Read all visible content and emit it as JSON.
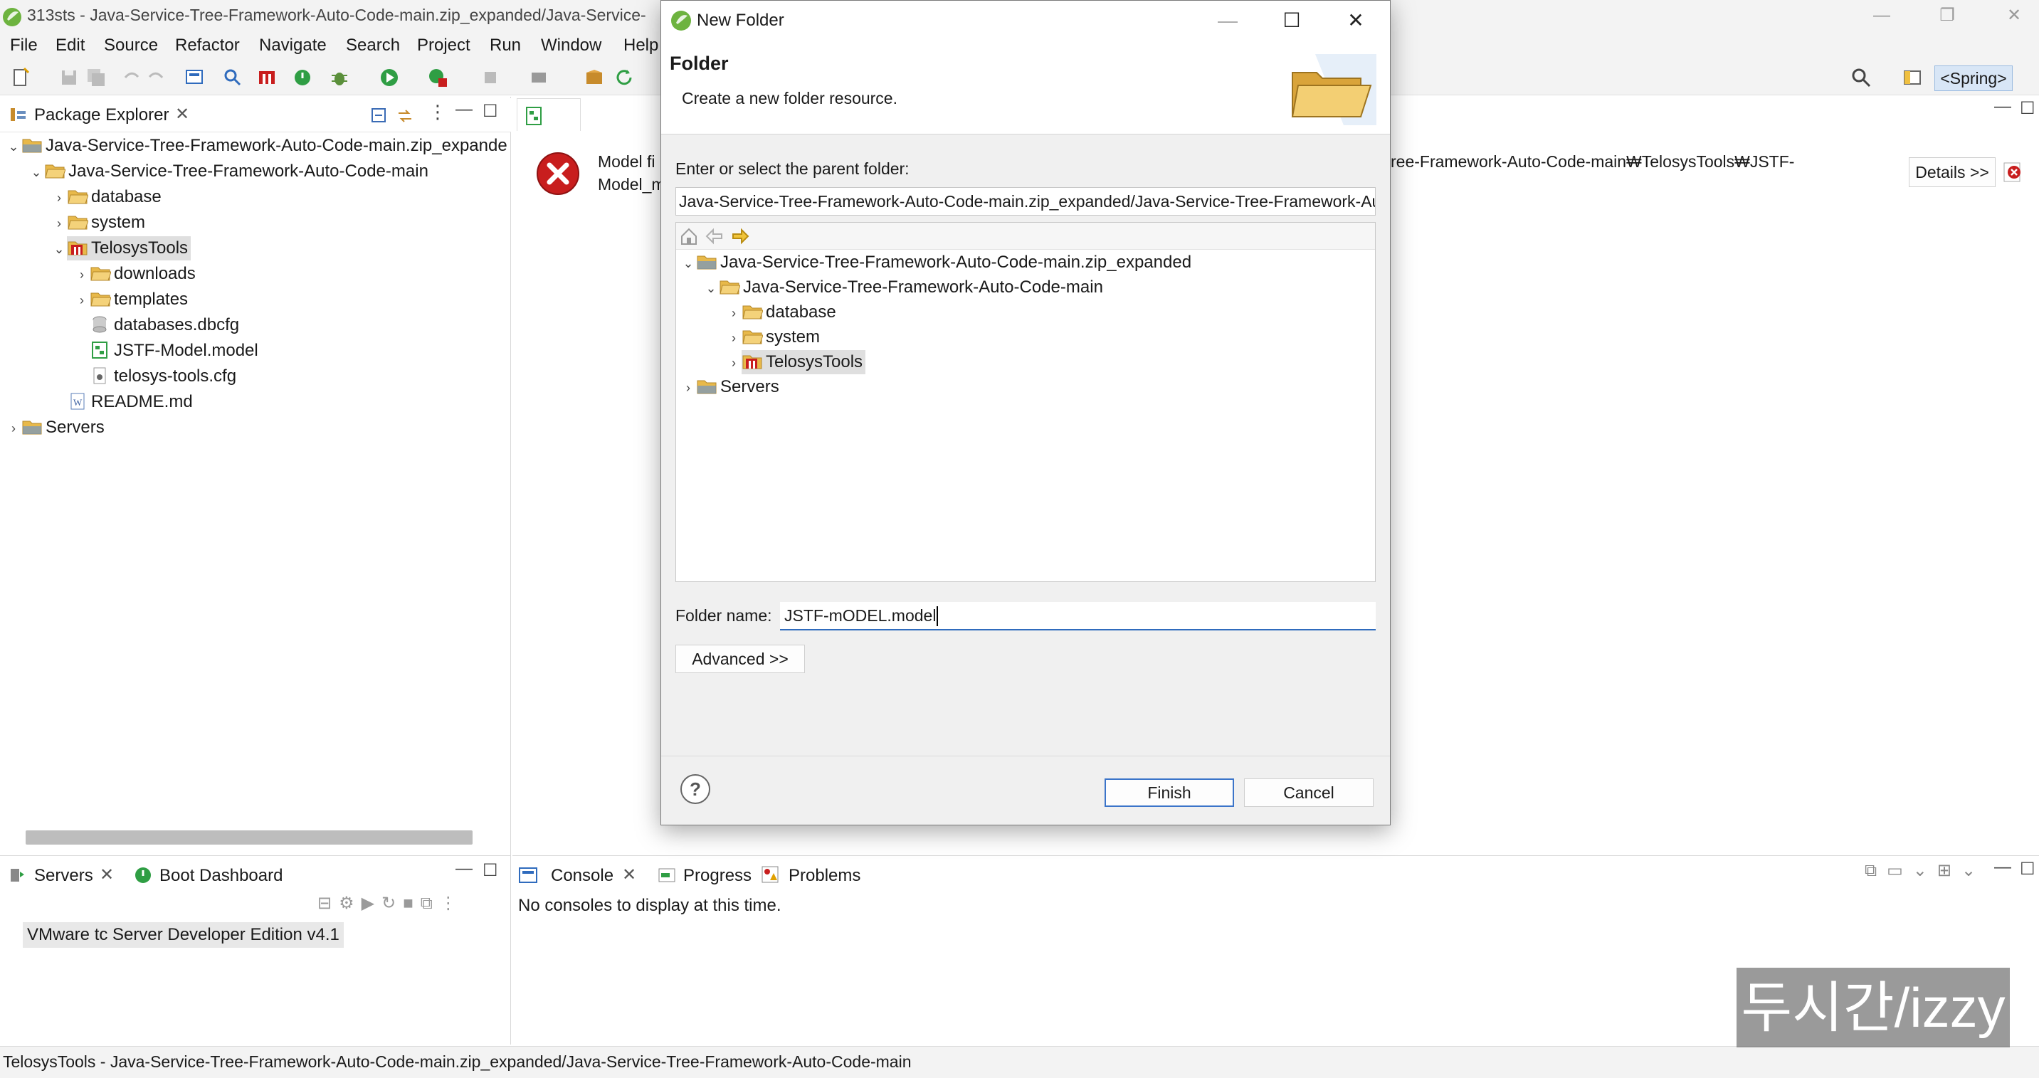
{
  "window": {
    "title": "313sts - Java-Service-Tree-Framework-Auto-Code-main.zip_expanded/Java-Service-",
    "controls": [
      "—",
      "❐",
      "✕"
    ]
  },
  "menu": [
    "File",
    "Edit",
    "Source",
    "Refactor",
    "Navigate",
    "Search",
    "Project",
    "Run",
    "Window",
    "Help"
  ],
  "toolbar": {
    "perspective_label": "<Spring>"
  },
  "package_explorer": {
    "tab_label": "Package Explorer",
    "tree": [
      {
        "label": "Java-Service-Tree-Framework-Auto-Code-main.zip_expande",
        "icon": "project-folder-icon",
        "expanded": true
      },
      {
        "label": "Java-Service-Tree-Framework-Auto-Code-main",
        "icon": "open-folder-icon",
        "expanded": true
      },
      {
        "label": "database",
        "icon": "folder-icon",
        "expanded": false
      },
      {
        "label": "system",
        "icon": "folder-icon",
        "expanded": false
      },
      {
        "label": "TelosysTools",
        "icon": "telosys-icon",
        "expanded": true,
        "selected": true
      },
      {
        "label": "downloads",
        "icon": "folder-icon",
        "expanded": false
      },
      {
        "label": "templates",
        "icon": "folder-icon",
        "expanded": false
      },
      {
        "label": "databases.dbcfg",
        "icon": "database-file-icon"
      },
      {
        "label": "JSTF-Model.model",
        "icon": "model-file-icon"
      },
      {
        "label": "telosys-tools.cfg",
        "icon": "config-file-icon"
      },
      {
        "label": "README.md",
        "icon": "markdown-file-icon"
      },
      {
        "label": "Servers",
        "icon": "servers-folder-icon",
        "expanded": false
      }
    ]
  },
  "servers_panel": {
    "tabs": [
      "Servers",
      "Boot Dashboard"
    ],
    "server": "VMware tc Server Developer Edition v4.1"
  },
  "editor": {
    "error_text_line1": "Model fi",
    "error_text_line2": "Model_m",
    "path_fragment": "ree-Framework-Auto-Code-main₩TelosysTools₩JSTF-",
    "details_label": "Details >>"
  },
  "console_panel": {
    "tabs": [
      "Console",
      "Progress",
      "Problems"
    ],
    "message": "No consoles to display at this time."
  },
  "status": "TelosysTools - Java-Service-Tree-Framework-Auto-Code-main.zip_expanded/Java-Service-Tree-Framework-Auto-Code-main",
  "watermark": "두시간/izzy",
  "dialog": {
    "title": "New Folder",
    "banner_title": "Folder",
    "banner_subtitle": "Create a new folder resource.",
    "parent_label": "Enter or select the parent folder:",
    "parent_value": "Java-Service-Tree-Framework-Auto-Code-main.zip_expanded/Java-Service-Tree-Framework-Auto-Code-main/TelosysTools",
    "tree": [
      {
        "label": "Java-Service-Tree-Framework-Auto-Code-main.zip_expanded",
        "icon": "project-folder-icon",
        "expanded": true
      },
      {
        "label": "Java-Service-Tree-Framework-Auto-Code-main",
        "icon": "open-folder-icon",
        "expanded": true
      },
      {
        "label": "database",
        "icon": "folder-icon",
        "expanded": false
      },
      {
        "label": "system",
        "icon": "folder-icon",
        "expanded": false
      },
      {
        "label": "TelosysTools",
        "icon": "telosys-icon",
        "expanded": false,
        "selected": true
      },
      {
        "label": "Servers",
        "icon": "servers-folder-icon",
        "expanded": false
      }
    ],
    "folder_name_label": "Folder name:",
    "folder_name_value": "JSTF-mODEL.model",
    "advanced_label": "Advanced >>",
    "help_label": "?",
    "finish_label": "Finish",
    "cancel_label": "Cancel"
  },
  "colors": {
    "accent": "#2f6bbd",
    "error": "#c81e1e",
    "folder": "#e8b94a"
  }
}
